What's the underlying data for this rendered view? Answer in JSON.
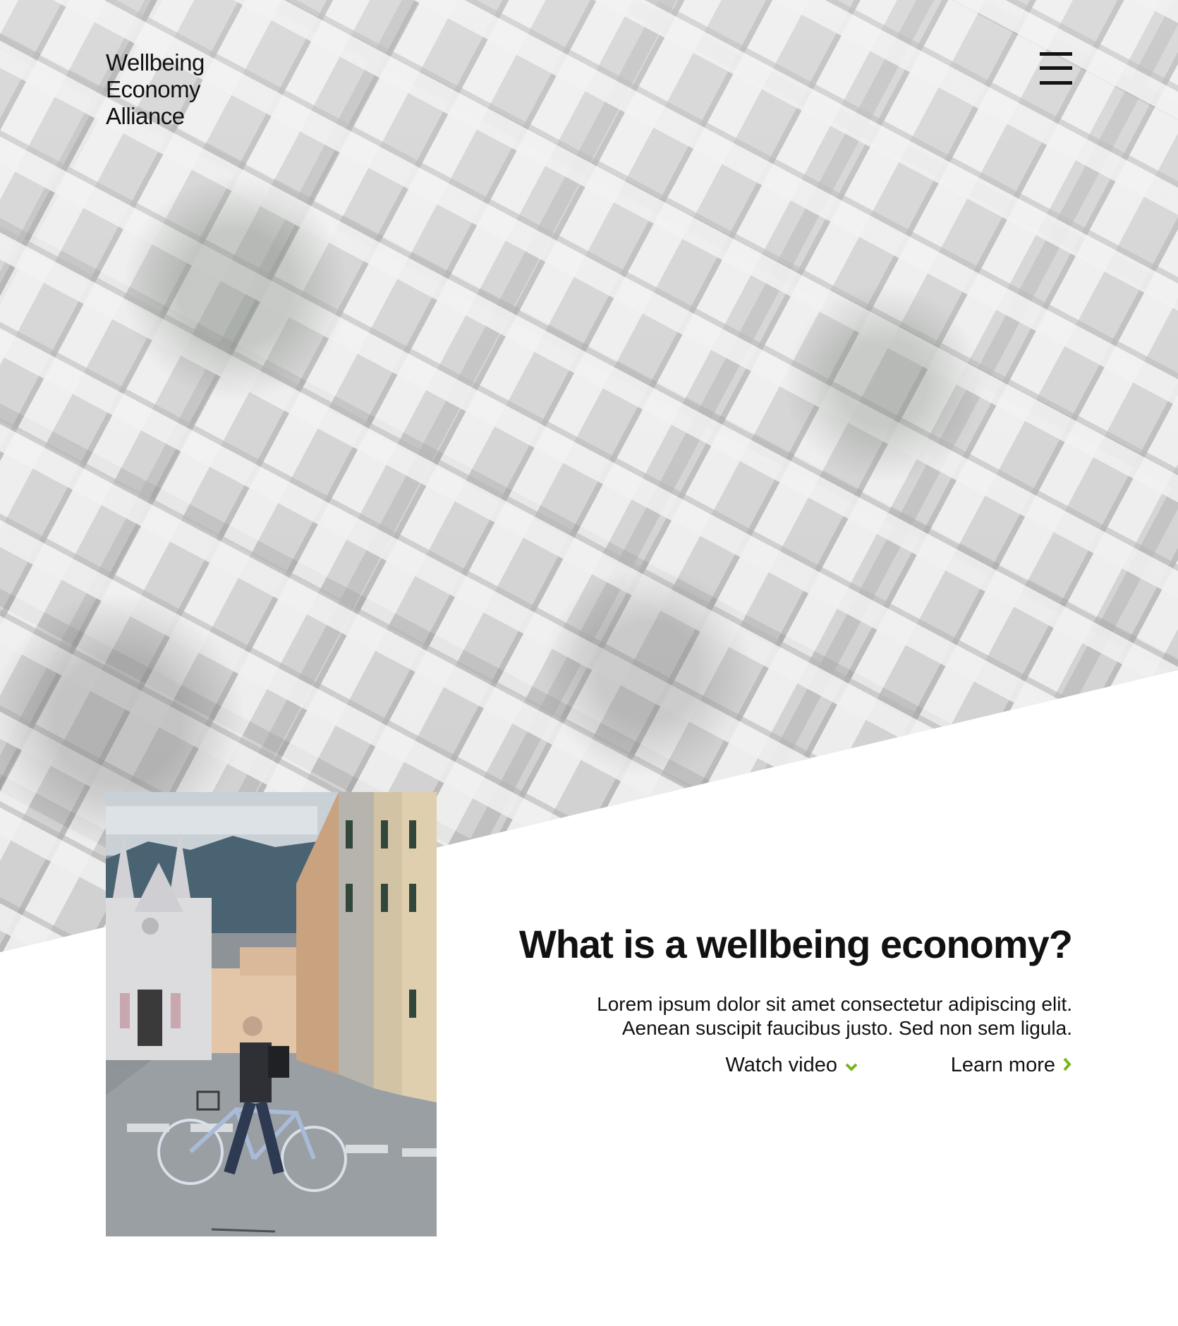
{
  "header": {
    "logo_lines": [
      "Wellbeing",
      "Economy",
      "Alliance"
    ],
    "menu_icon": "hamburger-menu-icon"
  },
  "hero": {
    "image": "aerial-city-grayscale"
  },
  "photo": {
    "image": "street-cyclist-with-gothic-church"
  },
  "content": {
    "heading": "What is a wellbeing economy?",
    "body_lines": [
      "Lorem ipsum dolor sit amet consectetur adipiscing elit.",
      "Aenean suscipit faucibus justo. Sed non sem ligula."
    ],
    "watch_video_label": "Watch video",
    "watch_video_icon": "chevron-down-icon",
    "learn_more_label": "Learn more",
    "learn_more_icon": "chevron-right-icon"
  },
  "colors": {
    "accent": "#7ab51d",
    "text": "#111111",
    "background": "#ffffff"
  }
}
